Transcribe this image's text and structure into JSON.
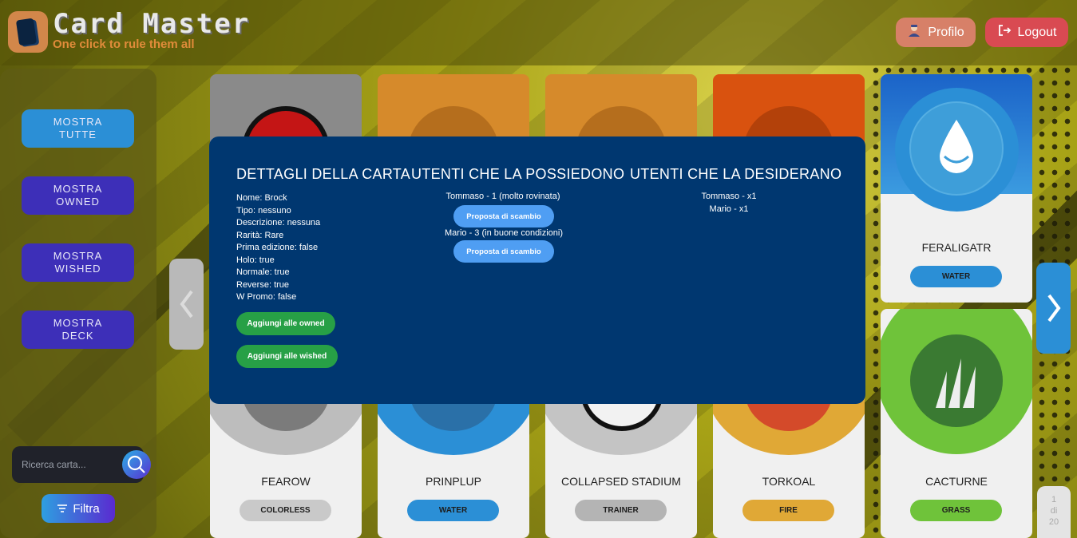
{
  "header": {
    "brand": "Card Master",
    "tagline": "One click to rule them all",
    "profile_label": "Profilo",
    "logout_label": "Logout"
  },
  "sidebar": {
    "buttons": [
      {
        "label": "MOSTRA TUTTE",
        "active": true
      },
      {
        "label": "MOSTRA OWNED",
        "active": false
      },
      {
        "label": "MOSTRA WISHED",
        "active": false
      },
      {
        "label": "MOSTRA DECK",
        "active": false
      }
    ],
    "search_placeholder": "Ricerca carta...",
    "filter_label": "Filtra"
  },
  "cards": [
    {
      "name": "FERALIGATR",
      "type": "WATER"
    },
    {
      "name": "FEAROW",
      "type": "COLORLESS"
    },
    {
      "name": "PRINPLUP",
      "type": "WATER"
    },
    {
      "name": "COLLAPSED STADIUM",
      "type": "TRAINER"
    },
    {
      "name": "TORKOAL",
      "type": "FIRE"
    },
    {
      "name": "CACTURNE",
      "type": "GRASS"
    }
  ],
  "colors": {
    "water": "#2b8fd6",
    "colorless": "#bdbdbd",
    "trainer": "#b4b4b4",
    "fire": "#e0a836",
    "grass": "#6fc33a",
    "modal_bg": "#003770"
  },
  "pagination": {
    "current": "1",
    "of": "di",
    "total": "20"
  },
  "modal": {
    "details_title": "DETTAGLI DELLA CARTA",
    "owners_title": "UTENTI CHE LA POSSIEDONO",
    "wishers_title": "UTENTI CHE LA DESIDERANO",
    "details": [
      "Nome: Brock",
      "Tipo: nessuno",
      "Descrizione: nessuna",
      "Rarità: Rare",
      "Prima edizione: false",
      "Holo: true",
      "Normale: true",
      "Reverse: true",
      "W Promo: false"
    ],
    "add_owned_label": "Aggiungi alle owned",
    "add_wished_label": "Aggiungi alle wished",
    "owners": [
      {
        "text": "Tommaso - 1 (molto rovinata)",
        "trade_label": "Proposta di scambio"
      },
      {
        "text": "Mario - 3 (in buone condizioni)",
        "trade_label": "Proposta di scambio"
      }
    ],
    "wishers": [
      "Tommaso - x1",
      "Mario - x1"
    ]
  }
}
